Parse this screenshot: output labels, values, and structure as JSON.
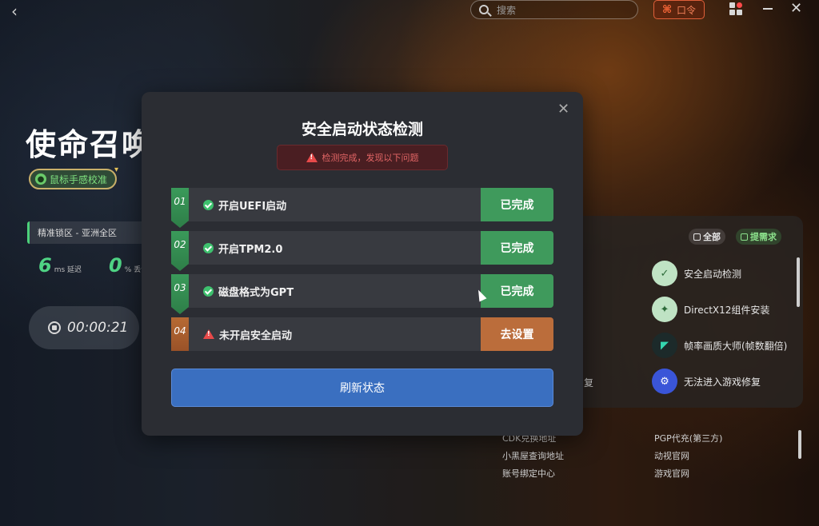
{
  "topbar": {
    "back_icon": "chevron-left-icon",
    "search_placeholder": "搜索",
    "kouling_label": "口令",
    "kouling_color": "#e0603a"
  },
  "game": {
    "title": "使命召唤",
    "calib_badge": "鼠标手感校准",
    "region": "精准锁区 - 亚洲全区",
    "latency_value": "6",
    "latency_unit": "ms 延迟",
    "loss_value": "0",
    "loss_unit": "% 丢包",
    "timer": "00:00:21"
  },
  "right_panel": {
    "chip_all": "全部",
    "chip_request": "提需求",
    "tools": [
      {
        "label": "安全启动检测",
        "icon": "shield-check-icon"
      },
      {
        "label": "DirectX12组件安装",
        "icon": "package-icon"
      },
      {
        "label": "帧率画质大师(帧数翻倍)",
        "icon": "fps-icon"
      },
      {
        "label": "无法进入游戏修复",
        "icon": "repair-icon"
      }
    ],
    "partial_text": "复",
    "links_left": [
      "CDK兑换地址",
      "小黑屋查询地址",
      "账号绑定中心"
    ],
    "links_right": [
      "PGP代充(第三方)",
      "动视官网",
      "游戏官网"
    ]
  },
  "modal": {
    "title": "安全启动状态检测",
    "warning": "检测完成，发现以下问题",
    "steps": [
      {
        "num": "01",
        "label": "开启UEFI启动",
        "status": "已完成",
        "state": "done"
      },
      {
        "num": "02",
        "label": "开启TPM2.0",
        "status": "已完成",
        "state": "done"
      },
      {
        "num": "03",
        "label": "磁盘格式为GPT",
        "status": "已完成",
        "state": "done"
      },
      {
        "num": "04",
        "label": "未开启安全启动",
        "status": "去设置",
        "state": "pending"
      }
    ],
    "refresh_label": "刷新状态",
    "colors": {
      "done": "#3f9a5c",
      "pending": "#bb6d3b",
      "primary": "#3a6fc0",
      "warning": "#e26565"
    }
  }
}
